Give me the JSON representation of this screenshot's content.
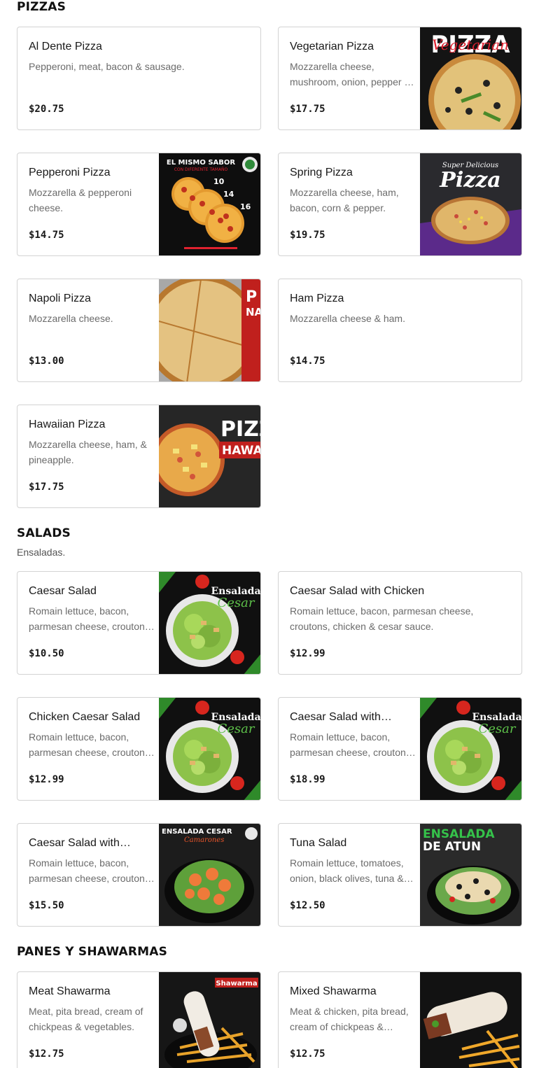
{
  "sections": {
    "pizzas": {
      "title": "PIZZAS"
    },
    "salads": {
      "title": "SALADS",
      "subtitle": "Ensaladas."
    },
    "panes": {
      "title": "PANES Y SHAWARMAS"
    }
  },
  "items": {
    "al_dente": {
      "name": "Al Dente Pizza",
      "desc": "Pepperoni, meat, bacon & sausage.",
      "price": "$20.75"
    },
    "vegetarian": {
      "name": "Vegetarian Pizza",
      "desc": "Mozzarella cheese, mushroom, onion, pepper & tomato.",
      "price": "$17.75",
      "img_text": "PIZZA",
      "img_script": "Vegetarian"
    },
    "pepperoni": {
      "name": "Pepperoni Pizza",
      "desc": "Mozzarella & pepperoni cheese.",
      "price": "$14.75",
      "img_text": "EL MISMO SABOR",
      "img_sub": "CON DIFERENTE TAMAÑO",
      "size_a": "10",
      "size_b": "14",
      "size_c": "16"
    },
    "spring": {
      "name": "Spring Pizza",
      "desc": "Mozzarella cheese, ham, bacon, corn & pepper.",
      "price": "$19.75",
      "img_text": "Pizza",
      "img_script": "Super Delicious"
    },
    "napoli": {
      "name": "Napoli Pizza",
      "desc": "Mozzarella cheese.",
      "price": "$13.00",
      "img_text": "P",
      "img_sub": "NA"
    },
    "ham": {
      "name": "Ham Pizza",
      "desc": "Mozzarella cheese & ham.",
      "price": "$14.75"
    },
    "hawaiian": {
      "name": "Hawaiian Pizza",
      "desc": "Mozzarella cheese, ham, & pineapple.",
      "price": "$17.75",
      "img_text": "PIZZ",
      "img_sub": "HAWAI"
    },
    "caesar": {
      "name": "Caesar Salad",
      "desc": "Romain lettuce, bacon, parmesan cheese, croutons & cesar sauce.",
      "price": "$10.50",
      "img_text": "Ensalada",
      "img_script": "Cesar"
    },
    "caesar_chicken": {
      "name": "Caesar Salad with Chicken",
      "desc": "Romain lettuce, bacon, parmesan cheese, croutons, chicken & cesar sauce.",
      "price": "$12.99"
    },
    "chicken_caesar": {
      "name": "Chicken Caesar Salad",
      "desc": "Romain lettuce, bacon, parmesan cheese, croutons & cesar sauce.",
      "price": "$12.99",
      "img_text": "Ensalada",
      "img_script": "Cesar"
    },
    "caesar_with_1": {
      "name": "Caesar Salad with…",
      "desc": "Romain lettuce, bacon, parmesan cheese, croutons & cesar sauce.",
      "price": "$18.99",
      "img_text": "Ensalada",
      "img_script": "Cesar"
    },
    "caesar_with_2": {
      "name": "Caesar Salad with…",
      "desc": "Romain lettuce, bacon, parmesan cheese, croutons & shrimp.",
      "price": "$15.50",
      "img_text": "ENSALADA CESAR",
      "img_script": "Camarones"
    },
    "tuna": {
      "name": "Tuna Salad",
      "desc": "Romain lettuce, tomatoes, onion, black olives, tuna & sauce.",
      "price": "$12.50",
      "img_text": "ENSALADA",
      "img_sub": "DE ATUN"
    },
    "meat_shawarma": {
      "name": "Meat Shawarma",
      "desc": "Meat, pita bread, cream of chickpeas & vegetables.",
      "price": "$12.75",
      "img_text": "Shawarma"
    },
    "mixed_shawarma": {
      "name": "Mixed Shawarma",
      "desc": "Meat & chicken, pita bread, cream of chickpeas & vegetables.",
      "price": "$12.75"
    }
  }
}
